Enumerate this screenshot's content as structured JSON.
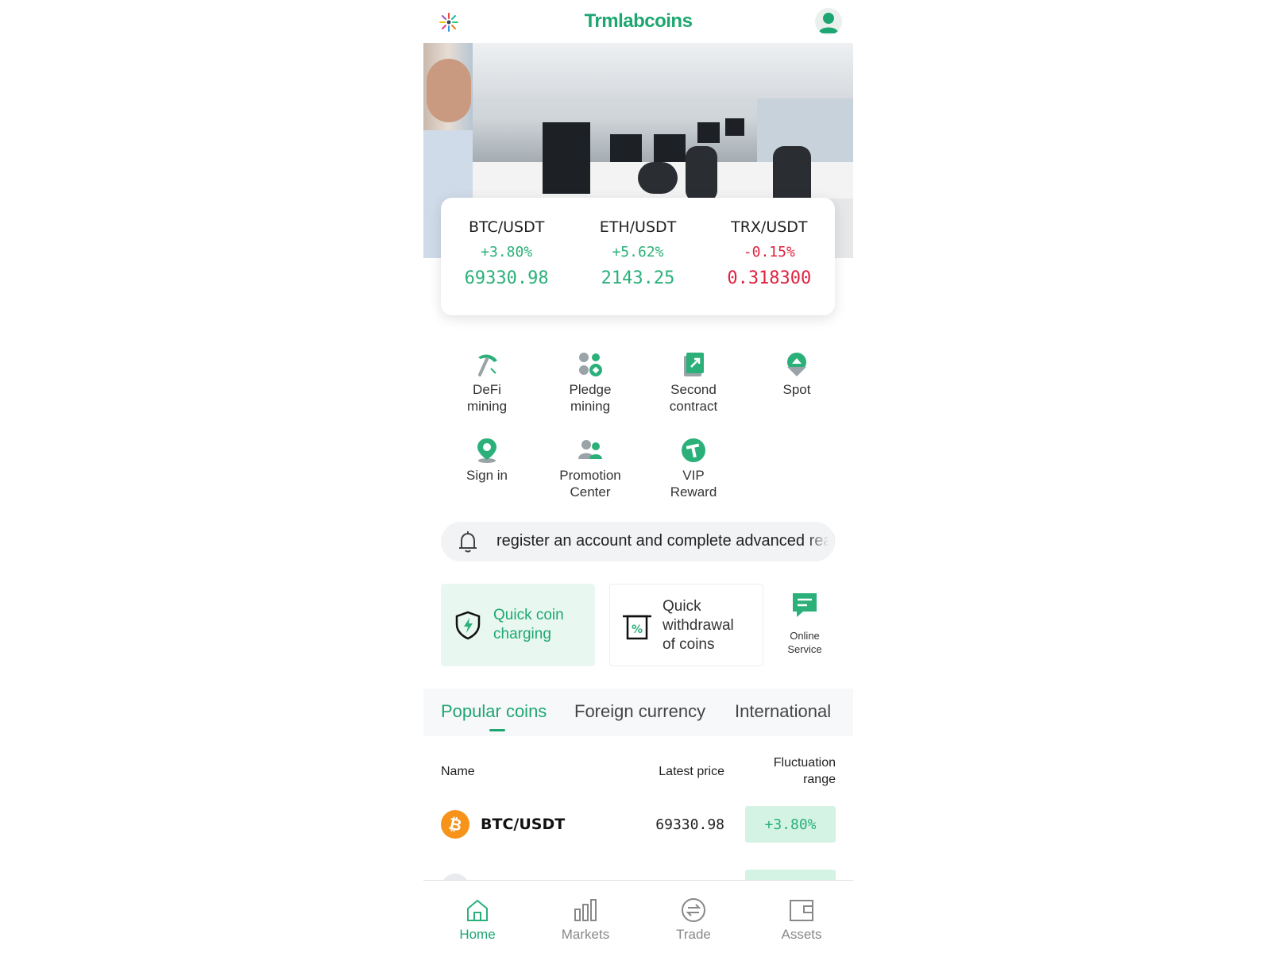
{
  "header": {
    "title": "Trmlabcoins",
    "logo_icon": "spark-logo-icon",
    "profile_icon": "user-avatar-icon"
  },
  "tickers": [
    {
      "pair": "BTC/USDT",
      "change": "+3.80%",
      "price": "69330.98",
      "trend": "up"
    },
    {
      "pair": "ETH/USDT",
      "change": "+5.62%",
      "price": "2143.25",
      "trend": "up"
    },
    {
      "pair": "TRX/USDT",
      "change": "-0.15%",
      "price": "0.318300",
      "trend": "down"
    }
  ],
  "features": [
    {
      "label": "DeFi\nmining",
      "icon": "pickaxe-icon"
    },
    {
      "label": "Pledge\nmining",
      "icon": "coins-pledge-icon"
    },
    {
      "label": "Second\ncontract",
      "icon": "contract-document-icon"
    },
    {
      "label": "Spot",
      "icon": "spot-upload-icon"
    },
    {
      "label": "Sign in",
      "icon": "location-pin-icon"
    },
    {
      "label": "Promotion\nCenter",
      "icon": "people-group-icon"
    },
    {
      "label": "VIP\nReward",
      "icon": "tether-coin-icon"
    }
  ],
  "notice": {
    "text": "register an account and complete advanced real-name authentication",
    "icon": "bell-icon"
  },
  "quick_actions": {
    "charge": {
      "label": "Quick coin\ncharging",
      "icon": "shield-bolt-icon"
    },
    "withdraw": {
      "label": "Quick\nwithdrawal\nof coins",
      "icon": "receipt-percent-icon"
    },
    "service": {
      "label": "Online\nService",
      "icon": "chat-message-icon"
    }
  },
  "tabs": [
    {
      "label": "Popular coins",
      "active": true
    },
    {
      "label": "Foreign currency",
      "active": false
    },
    {
      "label": "International",
      "active": false
    }
  ],
  "table": {
    "headers": {
      "name": "Name",
      "price": "Latest price",
      "change": "Fluctuation\nrange"
    },
    "rows": [
      {
        "name": "BTC/USDT",
        "price": "69330.98",
        "change": "+3.80%",
        "icon": "bitcoin-icon"
      }
    ]
  },
  "nav": [
    {
      "label": "Home",
      "icon": "home-icon",
      "active": true
    },
    {
      "label": "Markets",
      "icon": "bar-chart-icon",
      "active": false
    },
    {
      "label": "Trade",
      "icon": "exchange-icon",
      "active": false
    },
    {
      "label": "Assets",
      "icon": "wallet-icon",
      "active": false
    }
  ],
  "colors": {
    "brand": "#1ea672",
    "up": "#2bb07a",
    "down": "#e0223f",
    "change_bg": "#d4f3e5"
  }
}
